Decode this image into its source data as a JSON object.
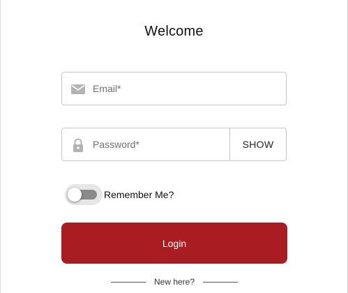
{
  "form": {
    "title": "Welcome",
    "email": {
      "placeholder": "Email*",
      "value": "",
      "icon": "envelope-icon"
    },
    "password": {
      "placeholder": "Password*",
      "value": "",
      "icon": "lock-icon",
      "show_label": "SHOW"
    },
    "remember": {
      "label": "Remember Me?",
      "checked": false
    },
    "login_label": "Login",
    "new_here_label": "New here?"
  },
  "colors": {
    "accent": "#a91d22",
    "icon": "#b3b3b3",
    "toggle_track": "#8a8a8a"
  }
}
